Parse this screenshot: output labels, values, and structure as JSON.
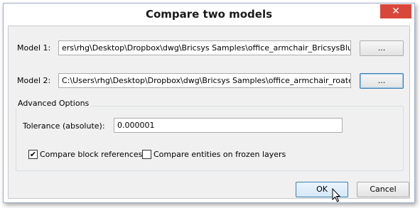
{
  "dialog": {
    "title": "Compare two models",
    "close_glyph": "✕"
  },
  "model1": {
    "label": "Model 1:",
    "value": "ers\\rhg\\Desktop\\Dropbox\\dwg\\Bricsys Samples\\office_armchair_BricsysBlue.dwg",
    "browse_label": "..."
  },
  "model2": {
    "label": "Model 2:",
    "value": "C:\\Users\\rhg\\Desktop\\Dropbox\\dwg\\Bricsys Samples\\office_armchair_roated.dwg",
    "browse_label": "..."
  },
  "advanced": {
    "group_label": "Advanced Options",
    "tolerance_label": "Tolerance (absolute):",
    "tolerance_value": "0.000001",
    "compare_block_refs": {
      "label": "Compare block references",
      "checked": true,
      "glyph": "✔"
    },
    "compare_frozen": {
      "label": "Compare entities on frozen layers",
      "checked": false
    }
  },
  "buttons": {
    "ok": "OK",
    "cancel": "Cancel"
  }
}
